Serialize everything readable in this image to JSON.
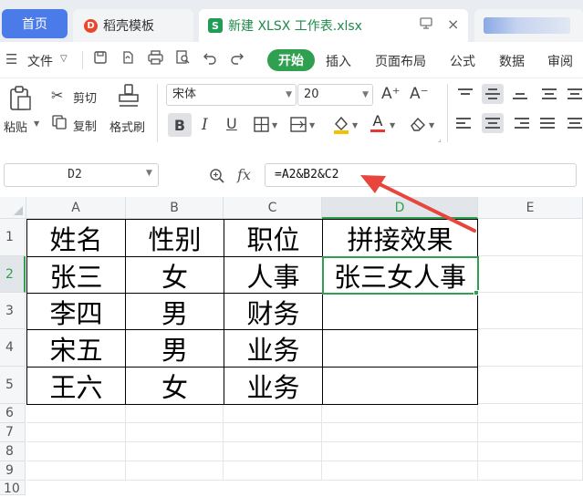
{
  "tabs": {
    "home": "首页",
    "doc": "稻壳模板",
    "doc_badge": "D",
    "xlsx": "新建 XLSX 工作表.xlsx",
    "xlsx_badge": "S"
  },
  "menubar": {
    "file": "文件",
    "items": [
      "开始",
      "插入",
      "页面布局",
      "公式",
      "数据",
      "审阅"
    ]
  },
  "ribbon": {
    "paste": "粘贴",
    "cut": "剪切",
    "copy": "复制",
    "format_painter": "格式刷",
    "font_name": "宋体",
    "font_size": "20",
    "grow_font": "A⁺",
    "shrink_font": "A⁻",
    "bold": "B",
    "italic": "I",
    "underline": "U"
  },
  "formula_bar": {
    "name_box": "D2",
    "fx": "fx",
    "formula": "=A2&B2&C2"
  },
  "sheet": {
    "columns": [
      "A",
      "B",
      "C",
      "D",
      "E"
    ],
    "rows": [
      "1",
      "2",
      "3",
      "4",
      "5",
      "6",
      "7",
      "8",
      "9",
      "10"
    ],
    "selected_cell": "D2",
    "table": [
      [
        "姓名",
        "性别",
        "职位",
        "拼接效果"
      ],
      [
        "张三",
        "女",
        "人事",
        "张三女人事"
      ],
      [
        "李四",
        "男",
        "财务",
        ""
      ],
      [
        "宋五",
        "男",
        "业务",
        ""
      ],
      [
        "王六",
        "女",
        "业务",
        ""
      ]
    ]
  },
  "colors": {
    "accent_green": "#2fa04f",
    "home_tab_blue": "#4a7be8",
    "annotation_arrow": "#e8453c"
  }
}
